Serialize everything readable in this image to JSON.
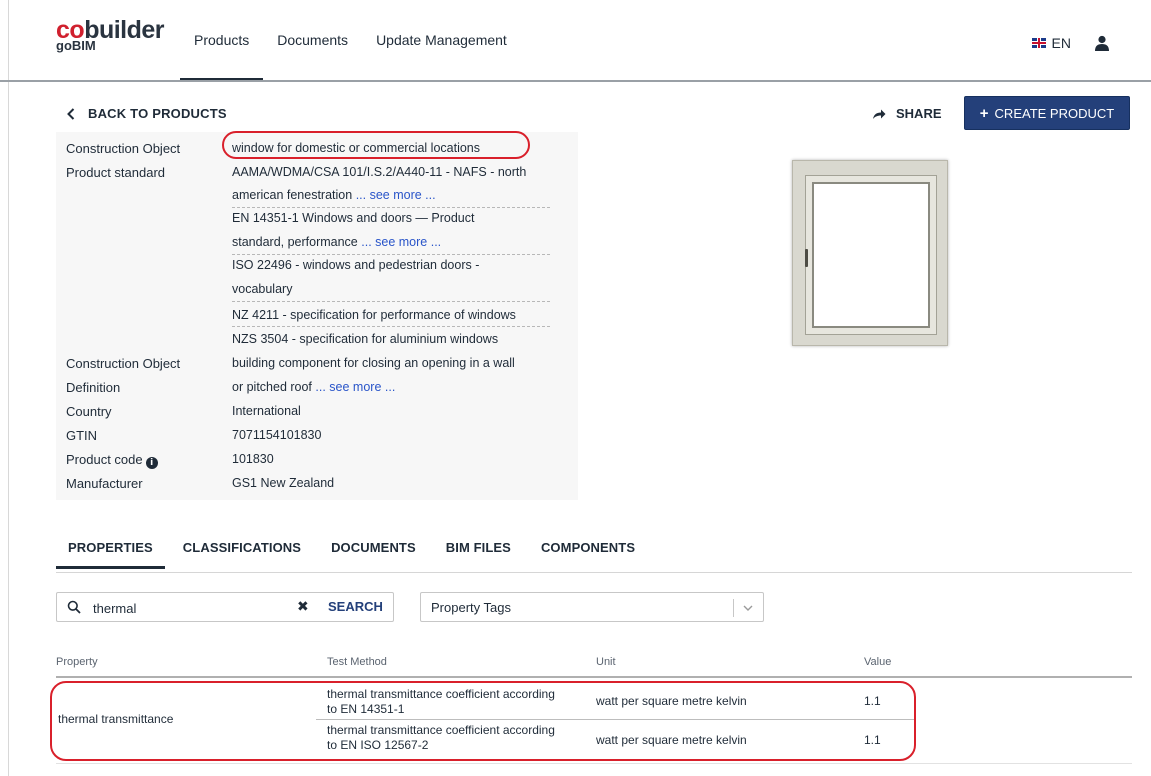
{
  "app": {
    "logo_main_prefix": "co",
    "logo_main_rest": "builder",
    "logo_sub": "goBIM"
  },
  "nav": {
    "items": [
      "Products",
      "Documents",
      "Update Management"
    ],
    "active": "Products",
    "language": "EN"
  },
  "header": {
    "back_label": "BACK TO PRODUCTS",
    "share_label": "SHARE",
    "create_label": "CREATE PRODUCT",
    "create_color": "#24407a"
  },
  "details": {
    "construction_object_label": "Construction Object",
    "construction_object_value": "window for domestic or commercial locations",
    "product_standard_label": "Product standard",
    "standards": [
      {
        "line1": "AAMA/WDMA/CSA 101/I.S.2/A440-11 - NAFS - north",
        "line2": "american fenestration",
        "see_more": "... see more ..."
      },
      {
        "line1": "EN 14351-1 Windows and doors — Product",
        "line2": "standard, performance",
        "see_more": "... see more ..."
      },
      {
        "line1": "ISO 22496 - windows and pedestrian doors -",
        "line2": "vocabulary",
        "see_more": ""
      },
      {
        "line1": "NZ 4211 - specification for performance of windows"
      },
      {
        "line1": "NZS 3504 - specification for aluminium windows"
      }
    ],
    "definition_label_1": "Construction Object",
    "definition_label_2": "Definition",
    "definition_line1": "building component for closing an opening in a wall",
    "definition_line2": "or pitched roof",
    "definition_see_more": "... see more ...",
    "country_label": "Country",
    "country_value": "International",
    "gtin_label": "GTIN",
    "gtin_value": "7071154101830",
    "product_code_label": "Product code",
    "product_code_value": "101830",
    "manufacturer_label": "Manufacturer",
    "manufacturer_value": "GS1 New Zealand",
    "highlight_color": "#d9202b"
  },
  "tabs": {
    "items": [
      "PROPERTIES",
      "CLASSIFICATIONS",
      "DOCUMENTS",
      "BIM FILES",
      "COMPONENTS"
    ],
    "active": "PROPERTIES"
  },
  "search": {
    "value": "thermal",
    "clear_glyph": "✖",
    "button_label": "SEARCH",
    "tags_placeholder": "Property Tags"
  },
  "table": {
    "headers": [
      "Property",
      "Test Method",
      "Unit",
      "Value"
    ],
    "property": "thermal transmittance",
    "rows": [
      {
        "method_line1": "thermal transmittance coefficient according",
        "method_line2": "to EN 14351-1",
        "unit": "watt per square metre kelvin",
        "value": "1.1"
      },
      {
        "method_line1": "thermal transmittance coefficient according",
        "method_line2": "to EN ISO 12567-2",
        "unit": "watt per square metre kelvin",
        "value": "1.1"
      }
    ]
  }
}
